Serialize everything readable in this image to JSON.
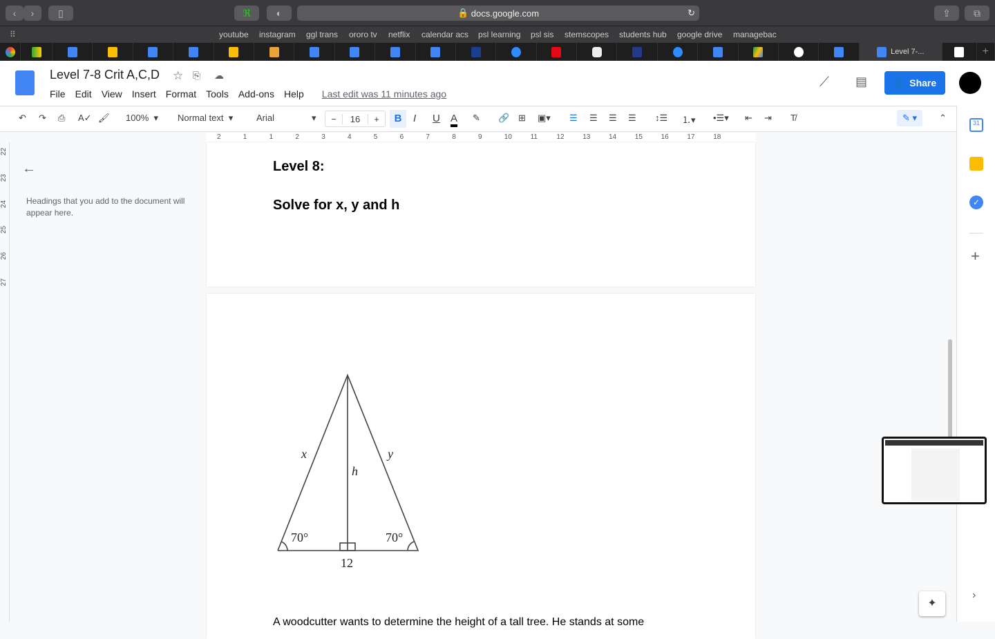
{
  "browser": {
    "url": "docs.google.com",
    "bookmarks": [
      "youtube",
      "instagram",
      "ggl trans",
      "ororo tv",
      "netflix",
      "calendar acs",
      "psl learning",
      "psl sis",
      "stemscopes",
      "students hub",
      "google drive",
      "managebac"
    ],
    "active_tab": "Level 7-..."
  },
  "doc": {
    "title": "Level 7-8 Crit A,C,D",
    "menu": [
      "File",
      "Edit",
      "View",
      "Insert",
      "Format",
      "Tools",
      "Add-ons",
      "Help"
    ],
    "last_edit": "Last edit was 11 minutes ago",
    "share": "Share"
  },
  "toolbar": {
    "zoom": "100%",
    "style": "Normal text",
    "font": "Arial",
    "size": "16"
  },
  "ruler": [
    "2",
    "1",
    "1",
    "2",
    "3",
    "4",
    "5",
    "6",
    "7",
    "8",
    "9",
    "10",
    "11",
    "12",
    "13",
    "14",
    "15",
    "16",
    "17",
    "18"
  ],
  "vruler": [
    "22",
    "23",
    "24",
    "25",
    "26",
    "27"
  ],
  "outline": {
    "empty": "Headings that you add to the document will appear here."
  },
  "content": {
    "heading1": "Level 8:",
    "heading2": "Solve for x, y and h",
    "fig": {
      "x": "x",
      "y": "y",
      "h": "h",
      "angle_left": "70°",
      "angle_right": "70°",
      "base": "12"
    },
    "para": "A woodcutter wants to determine the height of a tall tree. He stands at some"
  }
}
